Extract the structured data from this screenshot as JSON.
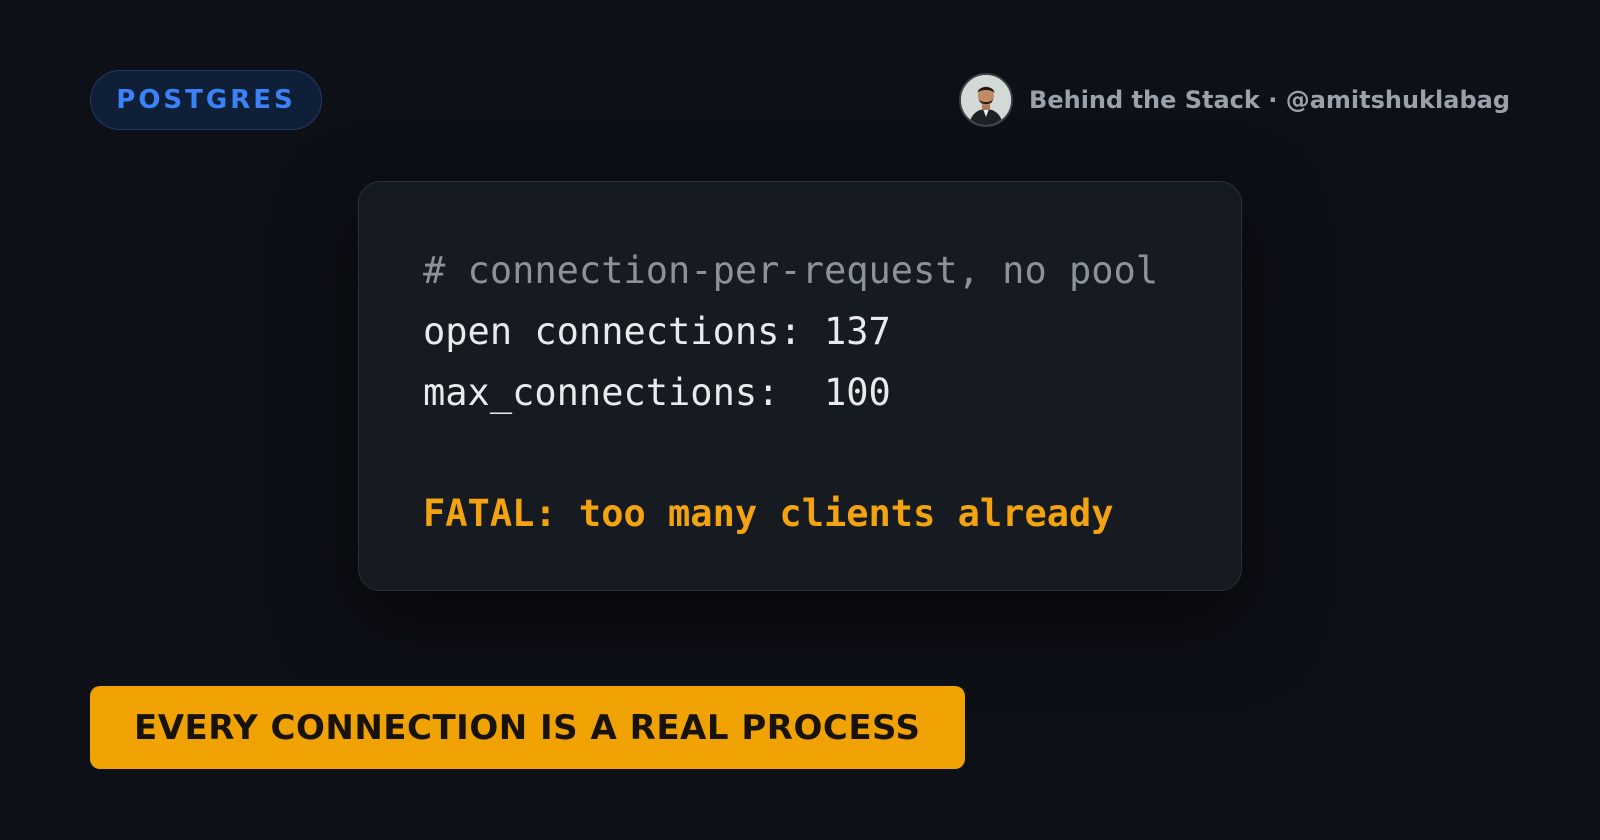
{
  "tag": {
    "label": "POSTGRES"
  },
  "author": {
    "line": "Behind the Stack · @amitshuklabag",
    "avatar_icon": "user-photo-avatar"
  },
  "code": {
    "comment": "# connection-per-request, no pool",
    "line1": "open connections: 137",
    "line2": "max_connections:  100",
    "fatal": "FATAL: too many clients already"
  },
  "banner": {
    "label": "EVERY CONNECTION IS A REAL PROCESS"
  },
  "colors": {
    "background": "#0d1017",
    "accent_blue": "#3b82f6",
    "accent_amber": "#f0a202",
    "card": "#161a21"
  }
}
